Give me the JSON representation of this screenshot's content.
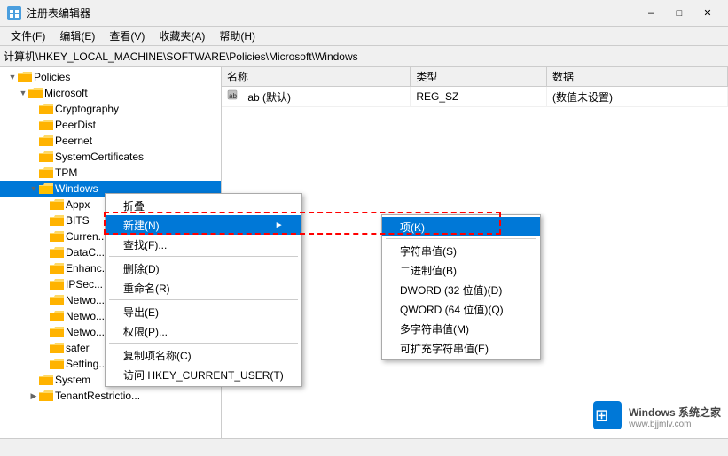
{
  "window": {
    "title": "注册表编辑器",
    "icon": "registry-editor-icon"
  },
  "menu": {
    "items": [
      "文件(F)",
      "编辑(E)",
      "查看(V)",
      "收藏夹(A)",
      "帮助(H)"
    ]
  },
  "address": {
    "label": "计算机\\HKEY_LOCAL_MACHINE\\SOFTWARE\\Policies\\Microsoft\\Windows",
    "path": "计算机\\HKEY_LOCAL_MACHINE\\SOFTWARE\\Policies\\Microsoft\\Windows"
  },
  "tree": {
    "items": [
      {
        "label": "Policies",
        "indent": 0,
        "expanded": true,
        "selected": false
      },
      {
        "label": "Microsoft",
        "indent": 1,
        "expanded": true,
        "selected": false
      },
      {
        "label": "Cryptography",
        "indent": 2,
        "expanded": false,
        "selected": false
      },
      {
        "label": "PeerDist",
        "indent": 2,
        "expanded": false,
        "selected": false
      },
      {
        "label": "Peernet",
        "indent": 2,
        "expanded": false,
        "selected": false
      },
      {
        "label": "SystemCertificates",
        "indent": 2,
        "expanded": false,
        "selected": false
      },
      {
        "label": "TPM",
        "indent": 2,
        "expanded": false,
        "selected": false
      },
      {
        "label": "Windows",
        "indent": 2,
        "expanded": true,
        "selected": true
      },
      {
        "label": "Appx",
        "indent": 3,
        "expanded": false,
        "selected": false
      },
      {
        "label": "BITS",
        "indent": 3,
        "expanded": false,
        "selected": false
      },
      {
        "label": "Curren...",
        "indent": 3,
        "expanded": false,
        "selected": false
      },
      {
        "label": "DataC...",
        "indent": 3,
        "expanded": false,
        "selected": false
      },
      {
        "label": "Enhanc...",
        "indent": 3,
        "expanded": false,
        "selected": false
      },
      {
        "label": "IPSec...",
        "indent": 3,
        "expanded": false,
        "selected": false
      },
      {
        "label": "Netwo...",
        "indent": 3,
        "expanded": false,
        "selected": false
      },
      {
        "label": "Netwo...",
        "indent": 3,
        "expanded": false,
        "selected": false
      },
      {
        "label": "Netwo...",
        "indent": 3,
        "expanded": false,
        "selected": false
      },
      {
        "label": "safer",
        "indent": 3,
        "expanded": false,
        "selected": false
      },
      {
        "label": "Setting...",
        "indent": 3,
        "expanded": false,
        "selected": false
      },
      {
        "label": "System",
        "indent": 2,
        "expanded": false,
        "selected": false
      },
      {
        "label": "TenantRestrictio...",
        "indent": 2,
        "expanded": false,
        "selected": false
      }
    ]
  },
  "registry_table": {
    "columns": [
      "名称",
      "类型",
      "数据"
    ],
    "rows": [
      {
        "name": "ab (默认)",
        "type": "REG_SZ",
        "data": "(数值未设置)"
      }
    ]
  },
  "context_menu": {
    "items": [
      {
        "label": "折叠",
        "shortcut": "",
        "has_arrow": false,
        "separator_after": false
      },
      {
        "label": "新建(N)",
        "shortcut": "",
        "has_arrow": true,
        "separator_after": false,
        "highlighted": true
      },
      {
        "label": "查找(F)...",
        "shortcut": "",
        "has_arrow": false,
        "separator_after": false
      },
      {
        "label": "删除(D)",
        "shortcut": "",
        "has_arrow": false,
        "separator_after": false
      },
      {
        "label": "重命名(R)",
        "shortcut": "",
        "has_arrow": false,
        "separator_after": true
      },
      {
        "label": "导出(E)",
        "shortcut": "",
        "has_arrow": false,
        "separator_after": false
      },
      {
        "label": "权限(P)...",
        "shortcut": "",
        "has_arrow": false,
        "separator_after": true
      },
      {
        "label": "复制项名称(C)",
        "shortcut": "",
        "has_arrow": false,
        "separator_after": false
      },
      {
        "label": "访问 HKEY_CURRENT_USER(T)",
        "shortcut": "",
        "has_arrow": false,
        "separator_after": false
      }
    ]
  },
  "submenu": {
    "items": [
      {
        "label": "项(K)",
        "highlighted": true
      },
      {
        "label": "字符串值(S)"
      },
      {
        "label": "二进制值(B)"
      },
      {
        "label": "DWORD (32 位值)(D)"
      },
      {
        "label": "QWORD (64 位值)(Q)"
      },
      {
        "label": "多字符串值(M)"
      },
      {
        "label": "可扩充字符串值(E)"
      }
    ]
  },
  "status_bar": {
    "text": ""
  },
  "watermark": {
    "site": "Windows 系统之家",
    "url": "www.bjjmlv.com"
  },
  "colors": {
    "highlight_blue": "#0078d7",
    "border_gray": "#aaa",
    "bg_light": "#f0f0f0",
    "dashed_red": "red"
  }
}
